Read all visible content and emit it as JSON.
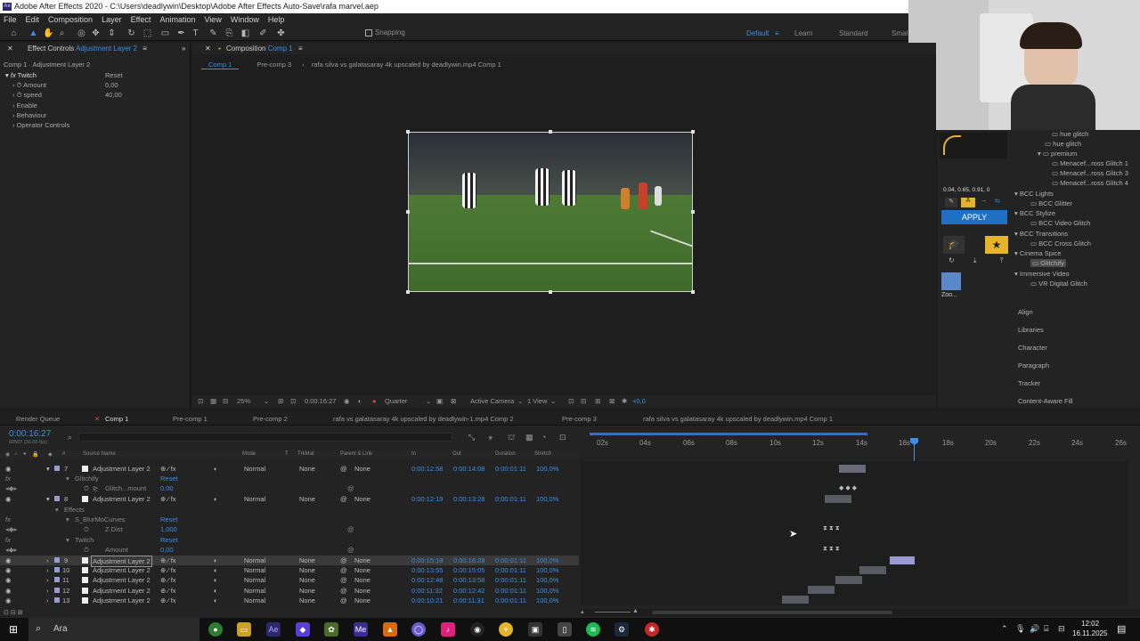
{
  "app": {
    "title": "Adobe After Effects 2020 - C:\\Users\\deadlywin\\Desktop\\Adobe After Effects Auto-Save\\rafa marvel.aep",
    "logo": "Ae"
  },
  "menu": [
    "File",
    "Edit",
    "Composition",
    "Layer",
    "Effect",
    "Animation",
    "View",
    "Window",
    "Help"
  ],
  "toolbar": {
    "snapping": "Snapping",
    "workspaces": [
      "Default",
      "Learn",
      "Standard",
      "Smal"
    ]
  },
  "effect_controls": {
    "tab_label": "Effect Controls",
    "tab_layer": "Adjustment Layer 2",
    "subtitle": "Comp 1 · Adjustment Layer 2",
    "fx_name": "Twitch",
    "reset": "Reset",
    "props": [
      {
        "label": "Amount",
        "value": "0,00"
      },
      {
        "label": "speed",
        "value": "40,00"
      },
      {
        "label": "Enable",
        "value": ""
      },
      {
        "label": "Behaviour",
        "value": ""
      },
      {
        "label": "Operator Controls",
        "value": ""
      }
    ]
  },
  "composition": {
    "tab_label": "Composition",
    "tab_name": "Comp 1",
    "breadcrumbs": [
      "Comp 1",
      "Pre-comp 3",
      "rafa silva vs galatasaray 4k upscaled by deadlywin.mp4 Comp 1"
    ],
    "bottom": {
      "zoom": "25%",
      "timecode": "0:00:16:27",
      "resolution": "Quarter",
      "camera": "Active Camera",
      "view": "1 View",
      "exposure": "+0,0"
    }
  },
  "right_panel": {
    "values": "0.04, 0.65, 0.91, 0",
    "apply": "APPLY",
    "zoo": "Zoo...",
    "tree": [
      {
        "label": "hue glitch",
        "indent": 2
      },
      {
        "label": "hue glitch",
        "indent": 2
      },
      {
        "label": "premium",
        "indent": 2
      },
      {
        "label": "Menacef...ross Glitch 1",
        "indent": 3
      },
      {
        "label": "Menacef...ross Glitch 3",
        "indent": 3
      },
      {
        "label": "Menacef...ross Glitch 4",
        "indent": 3
      },
      {
        "label": "BCC Lights",
        "indent": 0
      },
      {
        "label": "BCC Glitter",
        "indent": 1
      },
      {
        "label": "BCC Stylize",
        "indent": 0
      },
      {
        "label": "BCC Video Glitch",
        "indent": 1
      },
      {
        "label": "BCC Transitions",
        "indent": 0
      },
      {
        "label": "BCC Cross Glitch",
        "indent": 1
      },
      {
        "label": "Cinema Spice",
        "indent": 0
      },
      {
        "label": "Glitchify",
        "indent": 1
      },
      {
        "label": "Immersive Video",
        "indent": 0
      },
      {
        "label": "VR Digital Glitch",
        "indent": 1
      }
    ],
    "panels": [
      "Align",
      "Libraries",
      "Character",
      "Paragraph",
      "Tracker",
      "Content-Aware Fill"
    ]
  },
  "timeline": {
    "tabs": [
      "Render Queue",
      "Comp 1",
      "Pre-comp 1",
      "Pre-comp 2",
      "rafa vs galatasaray 4k upscaled by deadlywin-1.mp4 Comp 2",
      "Pre-comp 3",
      "rafa silva vs galatasaray 4k upscaled by deadlywin.mp4 Comp 1"
    ],
    "current_time": "0:00:16:27",
    "frame_info": "00507 (30.00 fps)",
    "columns": [
      "#",
      "Source Name",
      "Mode",
      "T",
      "TrkMat",
      "Parent & Link",
      "In",
      "Out",
      "Duration",
      "Stretch"
    ],
    "ruler": [
      "02s",
      "04s",
      "06s",
      "08s",
      "10s",
      "12s",
      "14s",
      "16s",
      "18s",
      "20s",
      "22s",
      "24s",
      "26s"
    ],
    "rows": [
      {
        "num": "7",
        "name": "Adjustment Layer 2",
        "mode": "Normal",
        "trk": "None",
        "parent": "None",
        "in": "0:00:12:58",
        "out": "0:00:14:08",
        "dur": "0:00:01:11",
        "stretch": "100,0%"
      },
      {
        "num": "8",
        "name": "Adjustment Layer 2",
        "mode": "Normal",
        "trk": "None",
        "parent": "None",
        "in": "0:00:12:19",
        "out": "0:00:13:28",
        "dur": "0:00:01:11",
        "stretch": "100,0%"
      },
      {
        "num": "9",
        "name": "Adjustment Layer 2",
        "mode": "Normal",
        "trk": "None",
        "parent": "None",
        "in": "0:00:15:18",
        "out": "0:00:16:28",
        "dur": "0:00:01:11",
        "stretch": "100,0%"
      },
      {
        "num": "10",
        "name": "Adjustment Layer 2",
        "mode": "Normal",
        "trk": "None",
        "parent": "None",
        "in": "0:00:13:55",
        "out": "0:00:15:05",
        "dur": "0:00:01:11",
        "stretch": "100,0%"
      },
      {
        "num": "11",
        "name": "Adjustment Layer 2",
        "mode": "Normal",
        "trk": "None",
        "parent": "None",
        "in": "0:00:12:48",
        "out": "0:00:13:58",
        "dur": "0:00:01:11",
        "stretch": "100,0%"
      },
      {
        "num": "12",
        "name": "Adjustment Layer 2",
        "mode": "Normal",
        "trk": "None",
        "parent": "None",
        "in": "0:00:11:32",
        "out": "0:00:12:42",
        "dur": "0:00:01:11",
        "stretch": "100,0%"
      },
      {
        "num": "13",
        "name": "Adjustment Layer 2",
        "mode": "Normal",
        "trk": "None",
        "parent": "None",
        "in": "0:00:10:21",
        "out": "0:00:11:31",
        "dur": "0:00:01:11",
        "stretch": "100,0%"
      }
    ],
    "sub": {
      "glitchify": "Glitchify",
      "glitch_amount": "Glitch...mount",
      "glitch_val": "0,00",
      "effects": "Effects",
      "blur": "S_BlurMoCurves",
      "zdist": "Z Dist",
      "zdist_val": "1,000",
      "twitch": "Twitch",
      "amount": "Amount",
      "amount_val": "0,00",
      "reset": "Reset"
    }
  },
  "taskbar": {
    "search": "Ara",
    "time": "12:02",
    "date": "16.11.2025"
  }
}
